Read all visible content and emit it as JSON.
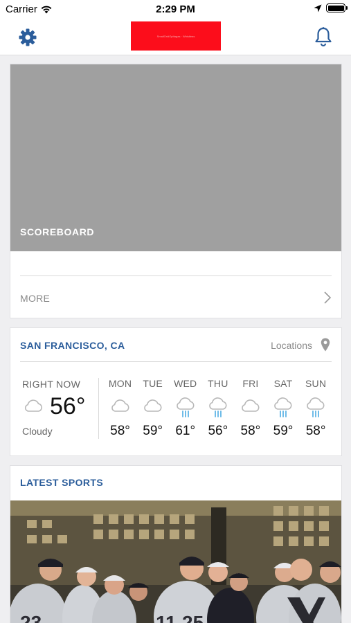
{
  "status_bar": {
    "carrier": "Carrier",
    "time": "2:29 PM"
  },
  "nav": {
    "left_icon": "gear-icon",
    "right_icon": "bell-icon",
    "accent": "#2b5d9b",
    "logo_color": "#fc0d1b",
    "logo_text": "SmallGridOpItagas · Whistleas"
  },
  "scoreboard": {
    "banner_label": "SCOREBOARD",
    "more_label": "MORE"
  },
  "weather": {
    "city": "SAN FRANCISCO, CA",
    "locations_label": "Locations",
    "now": {
      "label": "RIGHT NOW",
      "temp": "56°",
      "condition": "Cloudy",
      "icon": "cloud-icon"
    },
    "forecast": [
      {
        "day": "MON",
        "temp": "58°",
        "icon": "cloud-icon"
      },
      {
        "day": "TUE",
        "temp": "59°",
        "icon": "cloud-icon"
      },
      {
        "day": "WED",
        "temp": "61°",
        "icon": "rain-icon"
      },
      {
        "day": "THU",
        "temp": "56°",
        "icon": "rain-icon"
      },
      {
        "day": "FRI",
        "temp": "58°",
        "icon": "cloud-icon"
      },
      {
        "day": "SAT",
        "temp": "59°",
        "icon": "rain-icon"
      },
      {
        "day": "SUN",
        "temp": "58°",
        "icon": "rain-icon"
      }
    ]
  },
  "sports": {
    "title": "LATEST SPORTS"
  }
}
